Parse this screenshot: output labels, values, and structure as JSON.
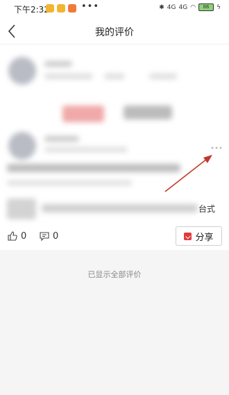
{
  "status_bar": {
    "time": "下午2:32",
    "app_icons": [
      {
        "name": "notification-app-icon-1",
        "color": "#f2b531"
      },
      {
        "name": "notification-app-icon-2",
        "color": "#f2b531"
      },
      {
        "name": "notification-app-icon-3",
        "color": "#f07a3a"
      }
    ],
    "more": "•••",
    "signal_1": "4G",
    "signal_2": "4G",
    "battery": "86"
  },
  "navbar": {
    "title": "我的评价",
    "back_icon": "chevron-left-icon"
  },
  "review_card": {
    "more_icon": "more-dots-icon",
    "partial_text": "台式",
    "like_count": "0",
    "comment_count": "0",
    "share_label": "分享",
    "share_icon_color": "#e03a3a",
    "annotation_arrow_color": "#c0392b"
  },
  "footer": {
    "text": "已显示全部评价"
  }
}
